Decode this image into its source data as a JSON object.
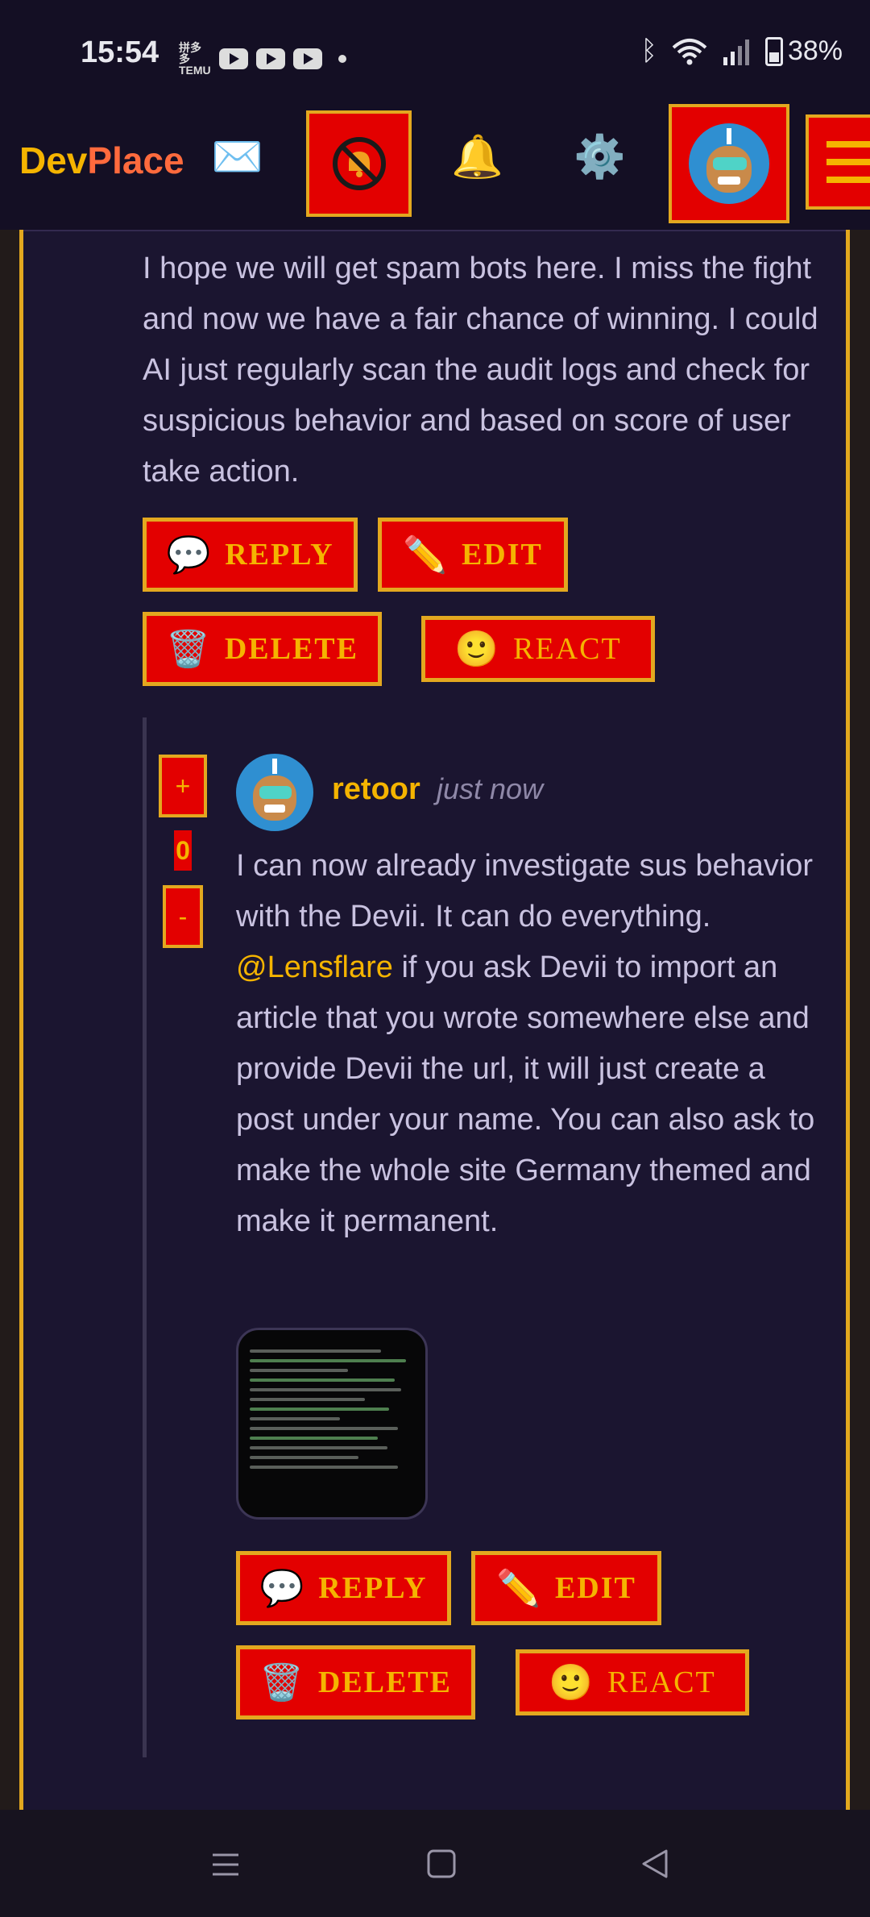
{
  "status_bar": {
    "time": "15:54",
    "temu_label": "拼多多TEMU",
    "battery": "38%"
  },
  "nav": {
    "brand_dev": "Dev",
    "brand_place": "Place",
    "icons": [
      "envelope-icon",
      "mute-bell-icon",
      "bell-icon",
      "gear-icon",
      "avatar",
      "hamburger-menu-icon"
    ]
  },
  "parent_comment": {
    "text": "I hope we will get spam bots here. I miss the fight and now we have a fair chance of winning. I could AI just regularly scan the audit logs and check for suspicious behavior and based on score of user take action.",
    "buttons": {
      "reply": "REPLY",
      "edit": "EDIT",
      "delete": "DELETE",
      "react": "REACT"
    }
  },
  "reply_comment": {
    "vote_up": "+",
    "score": "0",
    "vote_down": "-",
    "username": "retoor",
    "timestamp": "just now",
    "text_before": "I can now already investigate sus behavior with the Devii. It can do everything.",
    "mention": "@Lensflare",
    "text_after": "if you ask Devii to import an article that you wrote somewhere else and provide Devii the url, it will just create a post under your name. You can also ask to make the whole site Germany themed and make it permanent.",
    "buttons": {
      "reply": "REPLY",
      "edit": "EDIT",
      "delete": "DELETE",
      "react": "REACT"
    }
  },
  "colors": {
    "background": "#1b1530",
    "accent_gold": "#f5b400",
    "button_red": "#e30000",
    "border_gold": "#e3a81f"
  }
}
